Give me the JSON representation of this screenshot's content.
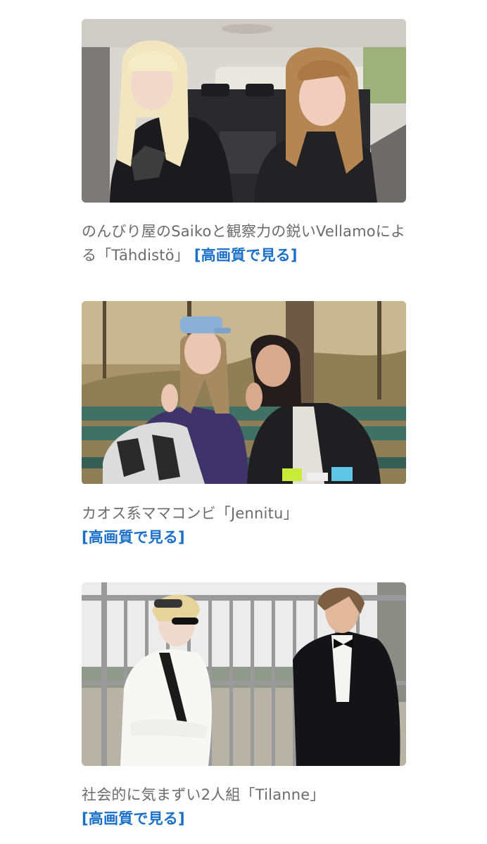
{
  "cards": [
    {
      "caption": "のんびり屋のSaikoと観察力の鋭いVellamoによる「Tähdistö」",
      "link_label": "[高画質で見る]",
      "image_alt": "Two women with long hair sitting in the front seats of a car"
    },
    {
      "caption": "カオス系ママコンビ「Jennitu」",
      "link_label": "[高画質で見る]",
      "image_alt": "Two women waving while sitting on a green park bench in a forest"
    },
    {
      "caption": "社会的に気まずい2人組「Tilanne」",
      "link_label": "[高画質で見る]",
      "image_alt": "Two people in shirts and bow ties standing in front of a metal fence"
    }
  ],
  "colors": {
    "caption_text": "#6b6b6b",
    "link": "#1a6fc9",
    "background": "#ffffff"
  }
}
